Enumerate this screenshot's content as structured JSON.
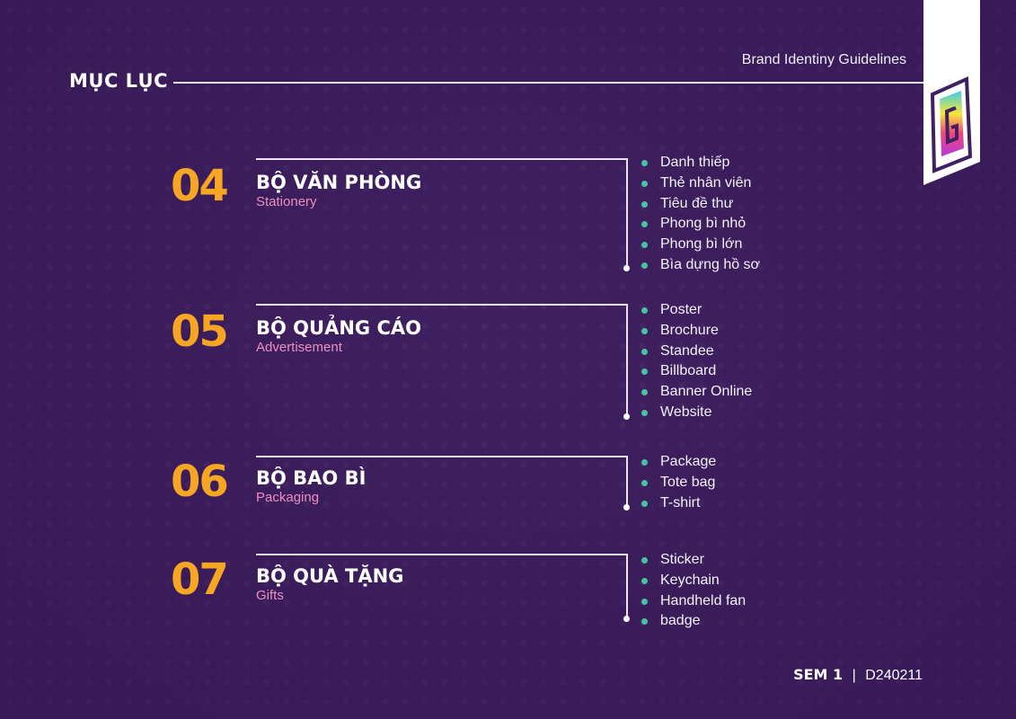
{
  "header": {
    "toc_title": "MỤC LỤC",
    "doc_title": "Brand Identiny Guidelines"
  },
  "sections": [
    {
      "number": "04",
      "title": "BỘ VĂN PHÒNG",
      "subtitle": "Stationery",
      "items": [
        "Danh thiếp",
        "Thẻ nhân viên",
        "Tiêu đề thư",
        "Phong bì nhỏ",
        "Phong bì lớn",
        "Bìa dựng hồ sơ"
      ]
    },
    {
      "number": "05",
      "title": "BỘ QUẢNG CÁO",
      "subtitle": "Advertisement",
      "items": [
        "Poster",
        "Brochure",
        "Standee",
        "Billboard",
        "Banner Online",
        "Website"
      ]
    },
    {
      "number": "06",
      "title": "BỘ BAO BÌ",
      "subtitle": "Packaging",
      "items": [
        "Package",
        "Tote bag",
        "T-shirt"
      ]
    },
    {
      "number": "07",
      "title": "BỘ QUÀ TẶNG",
      "subtitle": "Gifts",
      "items": [
        "Sticker",
        "Keychain",
        "Handheld fan",
        "badge"
      ]
    }
  ],
  "footer": {
    "semester": "SEM 1",
    "separator": "|",
    "code": "D240211"
  },
  "colors": {
    "background": "#3f2060",
    "accent_number": "#f6a623",
    "subtitle": "#ec8fbf",
    "bullet": "#45c4a2"
  }
}
